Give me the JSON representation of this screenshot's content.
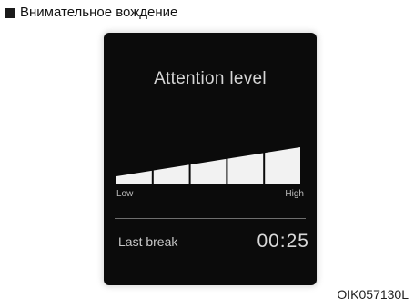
{
  "caption": {
    "text": "Внимательное вождение"
  },
  "display": {
    "title": "Attention level",
    "meter": {
      "segments": 5,
      "level_fraction": 1.0,
      "low_label": "Low",
      "high_label": "High"
    },
    "last_break_label": "Last break",
    "last_break_value": "00:25"
  },
  "figure_code": "OIK057130L",
  "colors": {
    "background": "#ffffff",
    "screen": "#0b0b0b",
    "meter_fill": "#f2f2f2",
    "text_light": "#d6d6d6"
  }
}
